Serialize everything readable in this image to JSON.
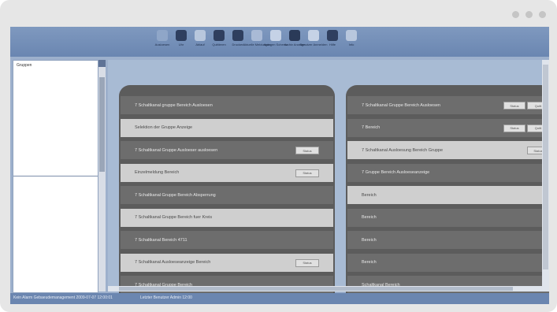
{
  "toolbar": {
    "buttons": [
      {
        "label": "Ausloesen",
        "color": "#8fa6c8"
      },
      {
        "label": "Uhr",
        "color": "#2f3f5f"
      },
      {
        "label": "Ablauf",
        "color": "#b8c7dd"
      },
      {
        "label": "Quittieren",
        "color": "#2f3f5f"
      },
      {
        "label": "Drucken",
        "color": "#2f3f5f"
      },
      {
        "label": "Aktuelle Meldungen",
        "color": "#a9bad6"
      },
      {
        "label": "Anlagen Schema",
        "color": "#c5d2e6"
      },
      {
        "label": "Archiv Anzeige",
        "color": "#2a3a58"
      },
      {
        "label": "Benutzer Anmelden",
        "color": "#c5d2e6"
      },
      {
        "label": "Hilfe",
        "color": "#2f3f5f"
      },
      {
        "label": "Info",
        "color": "#b8c7dd"
      }
    ]
  },
  "left_pane": {
    "label": "Gruppen"
  },
  "left_panel": {
    "rows": [
      {
        "text": "7 Schaltkanal gruppe Bereich Ausloesen",
        "style": "dark",
        "button": ""
      },
      {
        "text": "Selektion der Gruppe Anzeige",
        "style": "light",
        "button": ""
      },
      {
        "text": "7 Schaltkanal Gruppe Ausloeser ausloesen",
        "style": "dark",
        "button": "Status"
      },
      {
        "text": "Einzelmeldung Bereich",
        "style": "light",
        "button": "Status"
      },
      {
        "text": "7 Schaltkanal Gruppe Bereich Absperrung",
        "style": "dark",
        "button": ""
      },
      {
        "text": "7 Schaltkanal Gruppe Bereich fuer Kreis",
        "style": "light",
        "button": ""
      },
      {
        "text": "7 Schaltkanal Bereich 4711",
        "style": "dark",
        "button": ""
      },
      {
        "text": "7 Schaltkanal Ausloeseanzeige Bereich",
        "style": "light",
        "button": "Status"
      },
      {
        "text": "7 Schaltkanal Gruppe Bereich",
        "style": "dark",
        "button": ""
      }
    ]
  },
  "right_panel": {
    "rows": [
      {
        "text": "7 Schaltkanal Gruppe Bereich Ausloesen",
        "style": "dark",
        "buttons": [
          "Status",
          "Quitt"
        ]
      },
      {
        "text": "7 Bereich",
        "style": "dark",
        "buttons": [
          "Status",
          "Quitt"
        ]
      },
      {
        "text": "7 Schaltkanal Ausloesung Bereich Gruppe",
        "style": "light",
        "buttons": [
          "Status"
        ]
      },
      {
        "text": "7 Gruppe Bereich Ausloeseanzeige",
        "style": "dark",
        "buttons": []
      },
      {
        "text": "Bereich",
        "style": "light",
        "buttons": []
      },
      {
        "text": "Bereich",
        "style": "dark",
        "buttons": []
      },
      {
        "text": "Bereich",
        "style": "dark",
        "buttons": []
      },
      {
        "text": "Bereich",
        "style": "dark",
        "buttons": []
      },
      {
        "text": "Schaltkanal Bereich",
        "style": "dark",
        "buttons": []
      }
    ]
  },
  "status_bar": {
    "left": "Kein Alarm Gebaeudemanagement 2009-07-07 12:00:01",
    "right": "Letzter Benutzer Admin 12:00"
  }
}
